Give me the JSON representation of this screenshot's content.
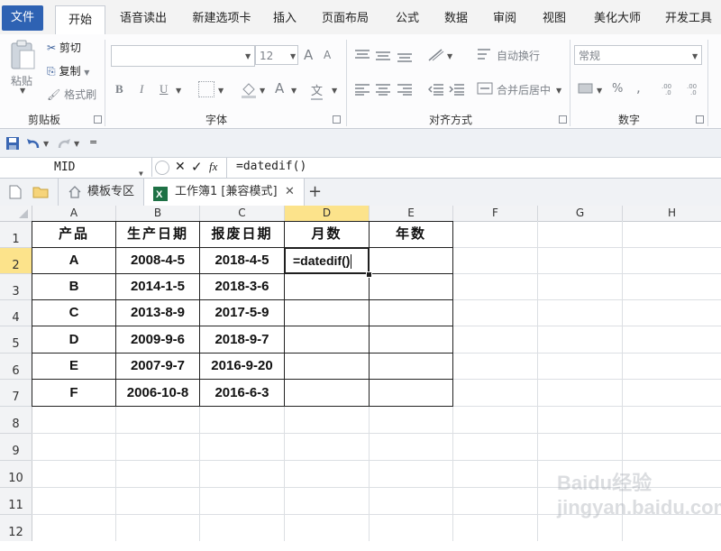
{
  "ribbon_tabs": [
    "文件",
    "开始",
    "语音读出",
    "新建选项卡",
    "插入",
    "页面布局",
    "公式",
    "数据",
    "审阅",
    "视图",
    "美化大师",
    "开发工具"
  ],
  "clipboard": {
    "paste": "粘贴",
    "cut": "剪切",
    "copy": "复制",
    "format_painter": "格式刷",
    "group": "剪贴板"
  },
  "font": {
    "size": "12",
    "group": "字体",
    "bold": "B",
    "italic": "I",
    "underline": "U",
    "grow": "A",
    "shrink": "A",
    "font_color": "A",
    "phonetic": "文"
  },
  "alignment": {
    "wrap": "自动换行",
    "merge": "合并后居中",
    "group": "对齐方式"
  },
  "number": {
    "format": "常规",
    "percent": "%",
    "comma": ",",
    "group": "数字"
  },
  "qat": {
    "save": "save-icon",
    "undo": "undo-icon",
    "redo": "redo-icon"
  },
  "formula_bar": {
    "name_box": "MID",
    "cancel": "✕",
    "enter": "✓",
    "fx": "fx",
    "formula": "=datedif()"
  },
  "doc_tabs": {
    "template": "模板专区",
    "workbook": "工作簿1 [兼容模式]",
    "close": "✕",
    "add": "+"
  },
  "columns": [
    "A",
    "B",
    "C",
    "D",
    "E",
    "F",
    "G",
    "H"
  ],
  "rows": [
    "1",
    "2",
    "3",
    "4",
    "5",
    "6",
    "7",
    "8",
    "9",
    "10",
    "11",
    "12"
  ],
  "table": {
    "headers": [
      "产品",
      "生产日期",
      "报废日期",
      "月数",
      "年数"
    ],
    "rows": [
      [
        "A",
        "2008-4-5",
        "2018-4-5",
        "=datedif()",
        ""
      ],
      [
        "B",
        "2014-1-5",
        "2018-3-6",
        "",
        ""
      ],
      [
        "C",
        "2013-8-9",
        "2017-5-9",
        "",
        ""
      ],
      [
        "D",
        "2009-9-6",
        "2018-9-7",
        "",
        ""
      ],
      [
        "E",
        "2007-9-7",
        "2016-9-20",
        "",
        ""
      ],
      [
        "F",
        "2006-10-8",
        "2016-6-3",
        "",
        ""
      ]
    ]
  },
  "watermark": "Baidu经验 jingyan.baidu.com",
  "colors": {
    "file_tab": "#2e62b3",
    "selected_header": "#fce38b",
    "active_border": "#1f1f1f",
    "excel_green": "#1e7145"
  }
}
